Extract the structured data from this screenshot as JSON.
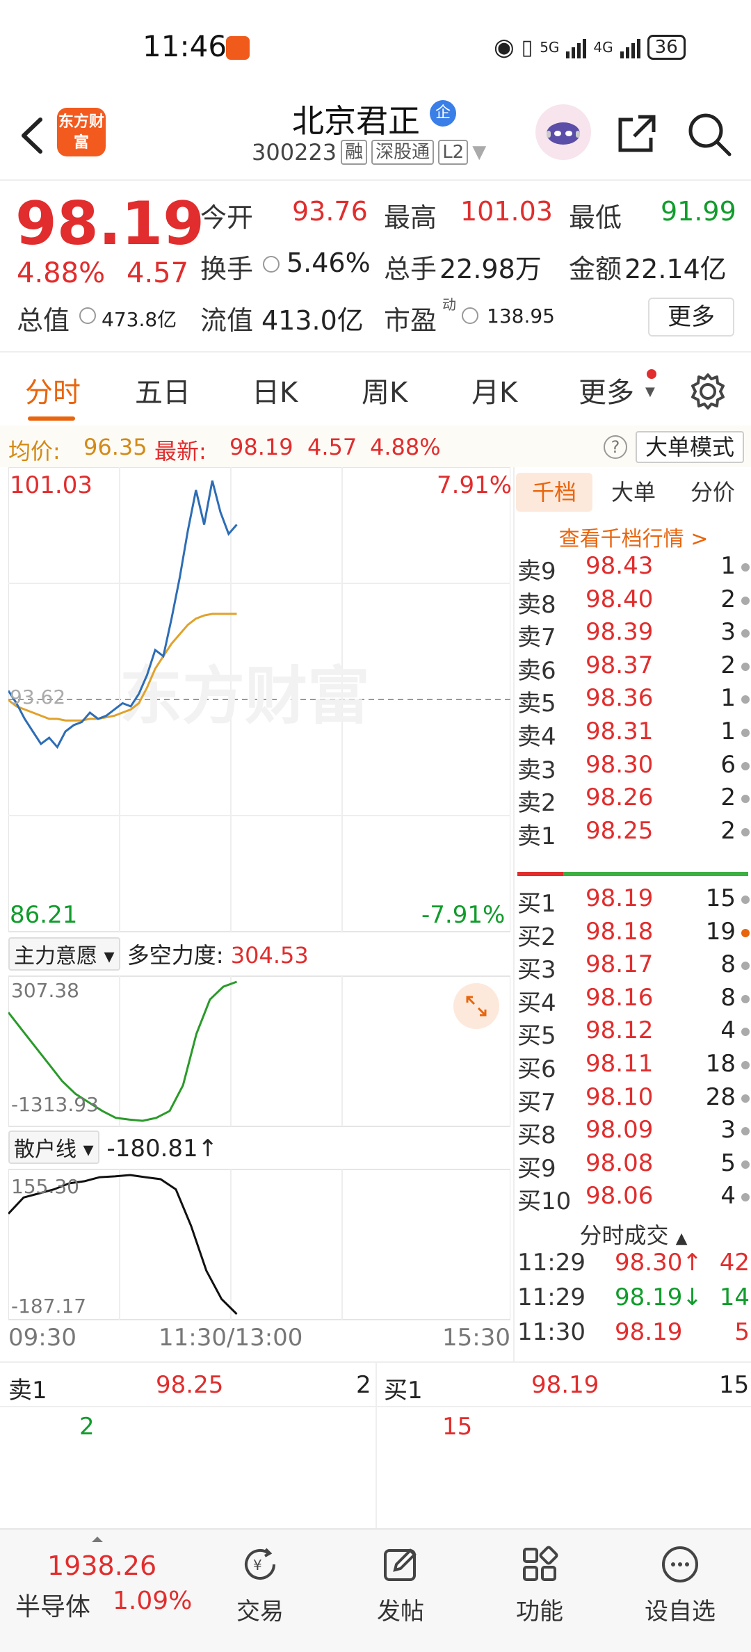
{
  "status_bar": {
    "time": "11:46",
    "network1": "5G",
    "network2": "4G",
    "battery": "36"
  },
  "header": {
    "logo_text": "东方财富",
    "stock_name": "北京君正",
    "badge": "企",
    "stock_code": "300223",
    "tags": [
      "融",
      "深股通",
      "L2"
    ]
  },
  "quote": {
    "price": "98.19",
    "change_pct": "4.88%",
    "change": "4.57",
    "fields": [
      {
        "label": "今开",
        "value": "93.76",
        "color": "red"
      },
      {
        "label": "最高",
        "value": "101.03",
        "color": "red"
      },
      {
        "label": "最低",
        "value": "91.99",
        "color": "green"
      },
      {
        "label": "换手",
        "value": "5.46%",
        "color": "black"
      },
      {
        "label": "总手",
        "value": "22.98万",
        "color": "black"
      },
      {
        "label": "金额",
        "value": "22.14亿",
        "color": "black"
      },
      {
        "label": "总值",
        "value": "473.8亿",
        "color": "black"
      },
      {
        "label": "流值",
        "value": "413.0亿",
        "color": "black"
      },
      {
        "label": "市盈",
        "value": "138.95",
        "color": "black"
      }
    ],
    "pe_superscript": "动",
    "more_label": "更多"
  },
  "tabs": [
    "分时",
    "五日",
    "日K",
    "周K",
    "月K",
    "更多"
  ],
  "avg_row": {
    "avg_label": "均价:",
    "avg_value": "96.35",
    "latest_label": "最新:",
    "latest_price": "98.19",
    "latest_change": "4.57",
    "latest_pct": "4.88%",
    "help": "?",
    "big_order_label": "大单模式"
  },
  "main_chart": {
    "high_label": "101.03",
    "low_label": "86.21",
    "high_pct": "7.91%",
    "low_pct": "-7.91%",
    "mid_label": "93.62",
    "watermark": "东方财富",
    "time_start": "09:30",
    "time_mid": "11:30/13:00",
    "time_end": "15:30"
  },
  "chart_data": [
    {
      "type": "line",
      "series": [
        {
          "values": [
            93.9,
            93.5,
            93.0,
            92.6,
            92.2,
            92.4,
            92.1,
            92.6,
            92.8,
            92.9,
            93.2,
            93.0,
            93.1,
            93.3,
            93.5,
            93.4,
            93.8,
            94.4,
            95.2,
            95.0,
            96.2,
            97.5,
            99.0,
            100.3,
            99.2,
            100.6,
            99.6,
            98.9,
            99.2
          ]
        },
        {
          "values": [
            93.6,
            93.4,
            93.3,
            93.2,
            93.1,
            93.0,
            93.0,
            92.95,
            92.95,
            92.95,
            93.0,
            93.0,
            93.05,
            93.1,
            93.2,
            93.3,
            93.5,
            94.0,
            94.6,
            95.0,
            95.4,
            95.7,
            96.0,
            96.2,
            96.3,
            96.35,
            96.35,
            96.35,
            96.35
          ]
        }
      ],
      "ylim": [
        86.21,
        101.03
      ]
    },
    {
      "type": "line",
      "series": [
        {
          "values": [
            -50,
            -250,
            -450,
            -650,
            -850,
            -1000,
            -1100,
            -1200,
            -1280,
            -1300,
            -1313.93,
            -1280,
            -1200,
            -900,
            -300,
            100,
            250,
            307.38
          ]
        }
      ],
      "ylim": [
        -1313.93,
        307.38
      ]
    },
    {
      "type": "line",
      "series": [
        {
          "values": [
            60,
            100,
            110,
            120,
            135,
            140,
            150,
            152,
            155.3,
            150,
            145,
            120,
            30,
            -80,
            -150,
            -187.17
          ]
        }
      ],
      "ylim": [
        -187.17,
        155.3
      ]
    }
  ],
  "sub1": {
    "selector": "主力意愿",
    "label": "多空力度:",
    "value": "304.53",
    "top_label": "307.38",
    "bottom_label": "-1313.93"
  },
  "sub2": {
    "selector": "散户线",
    "value": "-180.81↑",
    "top_label": "155.30",
    "bottom_label": "-187.17"
  },
  "book": {
    "tabs": [
      "千档",
      "大单",
      "分价"
    ],
    "link": "查看千档行情 >",
    "asks": [
      {
        "label": "卖9",
        "price": "98.43",
        "qty": "1"
      },
      {
        "label": "卖8",
        "price": "98.40",
        "qty": "2"
      },
      {
        "label": "卖7",
        "price": "98.39",
        "qty": "3"
      },
      {
        "label": "卖6",
        "price": "98.37",
        "qty": "2"
      },
      {
        "label": "卖5",
        "price": "98.36",
        "qty": "1"
      },
      {
        "label": "卖4",
        "price": "98.31",
        "qty": "1"
      },
      {
        "label": "卖3",
        "price": "98.30",
        "qty": "6"
      },
      {
        "label": "卖2",
        "price": "98.26",
        "qty": "2"
      },
      {
        "label": "卖1",
        "price": "98.25",
        "qty": "2"
      }
    ],
    "bids": [
      {
        "label": "买1",
        "price": "98.19",
        "qty": "15"
      },
      {
        "label": "买2",
        "price": "98.18",
        "qty": "19"
      },
      {
        "label": "买3",
        "price": "98.17",
        "qty": "8"
      },
      {
        "label": "买4",
        "price": "98.16",
        "qty": "8"
      },
      {
        "label": "买5",
        "price": "98.12",
        "qty": "4"
      },
      {
        "label": "买6",
        "price": "98.11",
        "qty": "18"
      },
      {
        "label": "买7",
        "price": "98.10",
        "qty": "28"
      },
      {
        "label": "买8",
        "price": "98.09",
        "qty": "3"
      },
      {
        "label": "买9",
        "price": "98.08",
        "qty": "5"
      },
      {
        "label": "买10",
        "price": "98.06",
        "qty": "4"
      }
    ],
    "trades_title": "分时成交",
    "trades": [
      {
        "time": "11:29",
        "price": "98.30↑",
        "vol": "42",
        "color": "red"
      },
      {
        "time": "11:29",
        "price": "98.19↓",
        "vol": "14",
        "color": "green"
      },
      {
        "time": "11:30",
        "price": "98.19",
        "vol": "5",
        "color": "red"
      }
    ]
  },
  "level1": {
    "sell_label": "卖1",
    "sell_price": "98.25",
    "sell_qty": "2",
    "sell_detail": "2",
    "buy_label": "买1",
    "buy_price": "98.19",
    "buy_qty": "15",
    "buy_detail": "15"
  },
  "bottom_nav": {
    "index_value": "1938.26",
    "index_name": "半导体",
    "index_pct": "1.09%",
    "items": [
      "交易",
      "发帖",
      "功能",
      "设自选"
    ]
  }
}
